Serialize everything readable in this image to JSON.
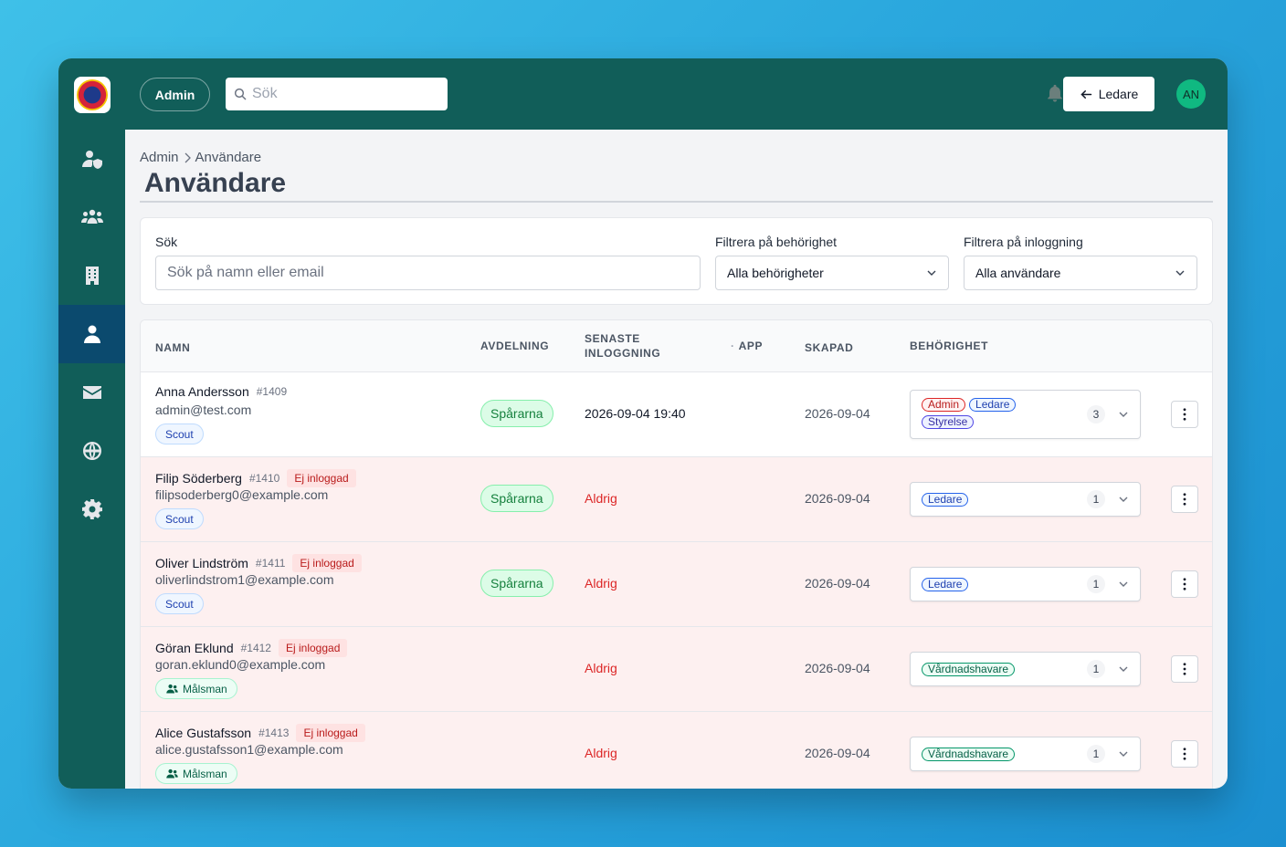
{
  "topbar": {
    "admin_label": "Admin",
    "search_placeholder": "Sök",
    "ledare_label": "Ledare",
    "avatar_initials": "AN"
  },
  "sidebar": {
    "items": [
      {
        "icon": "user-shield-icon"
      },
      {
        "icon": "users-group-icon"
      },
      {
        "icon": "building-icon"
      },
      {
        "icon": "user-icon",
        "active": true
      },
      {
        "icon": "envelope-icon"
      },
      {
        "icon": "globe-icon"
      },
      {
        "icon": "gear-icon"
      }
    ]
  },
  "breadcrumb": {
    "root": "Admin",
    "current": "Användare"
  },
  "page_title": "Användare",
  "filters": {
    "search_label": "Sök",
    "search_placeholder": "Sök på namn eller email",
    "permission_label": "Filtrera på behörighet",
    "permission_value": "Alla behörigheter",
    "login_label": "Filtrera på inloggning",
    "login_value": "Alla användare"
  },
  "table": {
    "headers": {
      "name": "NAMN",
      "dept": "AVDELNING",
      "last_login_1": "SENASTE",
      "last_login_2": "INLOGGNING",
      "app": "APP",
      "created": "SKAPAD",
      "permission": "BEHÖRIGHET"
    },
    "rows": [
      {
        "name": "Anna Andersson",
        "id": "#1409",
        "badge": "",
        "email": "admin@test.com",
        "tag": "Scout",
        "dept": "Spårarna",
        "last_login": "2026-09-04 19:40",
        "created": "2026-09-04",
        "perms": [
          "Admin",
          "Ledare",
          "Styrelse"
        ],
        "count": "3"
      },
      {
        "name": "Filip Söderberg",
        "id": "#1410",
        "badge": "Ej inloggad",
        "email": "filipsoderberg0@example.com",
        "tag": "Scout",
        "dept": "Spårarna",
        "last_login": "Aldrig",
        "created": "2026-09-04",
        "perms": [
          "Ledare"
        ],
        "count": "1"
      },
      {
        "name": "Oliver Lindström",
        "id": "#1411",
        "badge": "Ej inloggad",
        "email": "oliverlindstrom1@example.com",
        "tag": "Scout",
        "dept": "Spårarna",
        "last_login": "Aldrig",
        "created": "2026-09-04",
        "perms": [
          "Ledare"
        ],
        "count": "1"
      },
      {
        "name": "Göran Eklund",
        "id": "#1412",
        "badge": "Ej inloggad",
        "email": "goran.eklund0@example.com",
        "tag": "Målsman",
        "dept": "",
        "last_login": "Aldrig",
        "created": "2026-09-04",
        "perms": [
          "Vårdnadshavare"
        ],
        "count": "1"
      },
      {
        "name": "Alice Gustafsson",
        "id": "#1413",
        "badge": "Ej inloggad",
        "email": "alice.gustafsson1@example.com",
        "tag": "Målsman",
        "dept": "",
        "last_login": "Aldrig",
        "created": "2026-09-04",
        "perms": [
          "Vårdnadshavare"
        ],
        "count": "1"
      }
    ]
  },
  "colors": {
    "topbar": "#115e59",
    "sidebar_active": "#0b4a6e",
    "never_row": "#fdf0f0",
    "never_text": "#dc2626"
  }
}
